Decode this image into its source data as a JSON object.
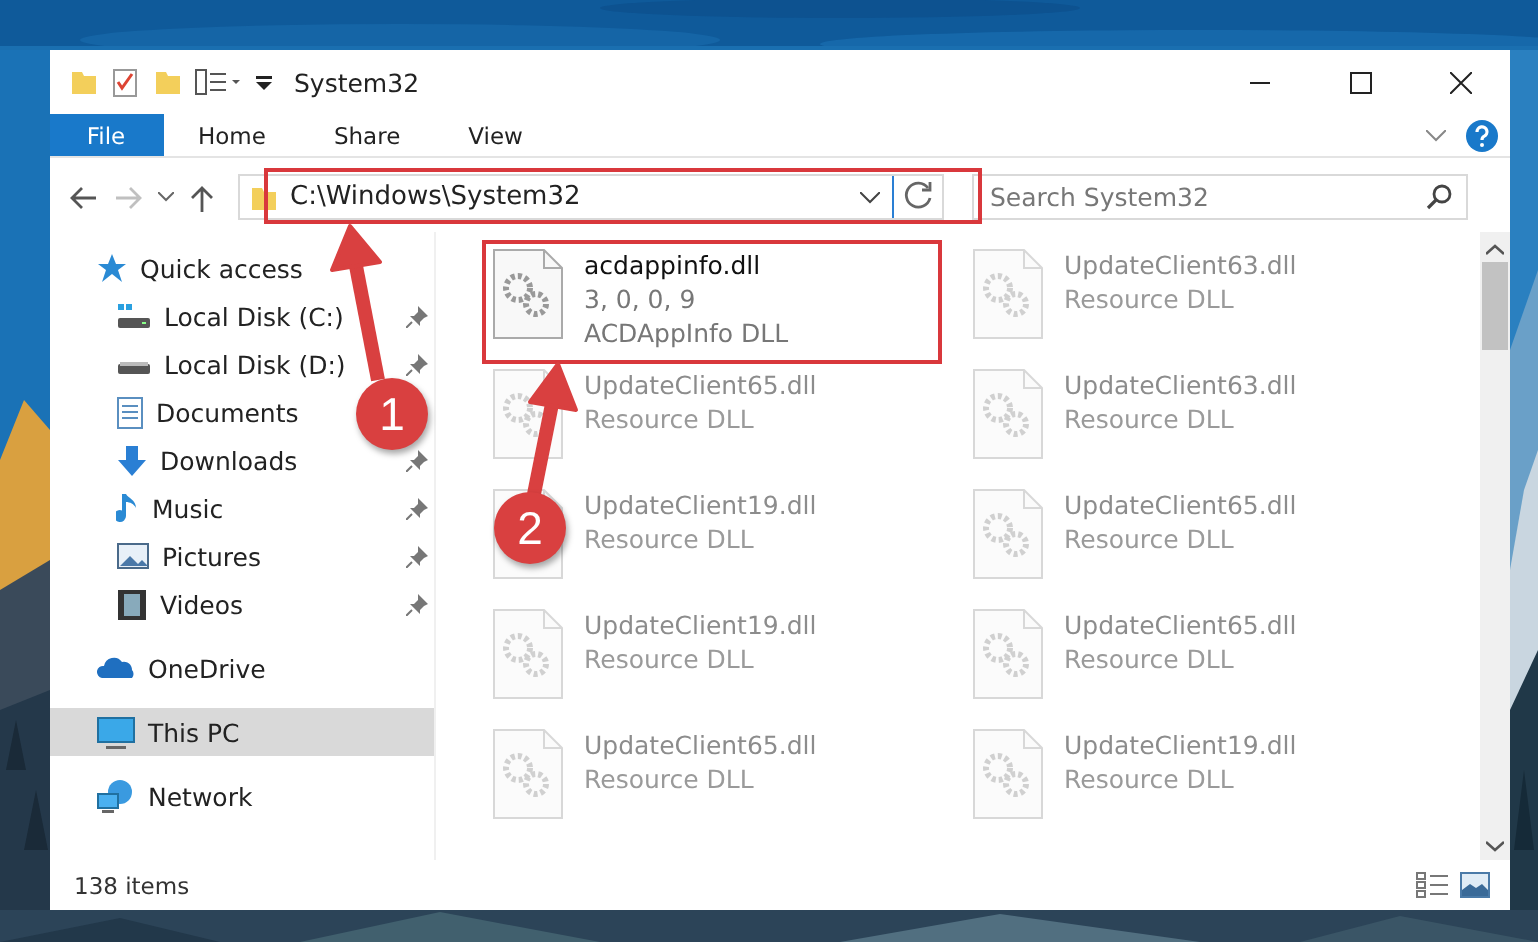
{
  "window": {
    "title": "System32"
  },
  "ribbon_tabs": [
    {
      "label": "File",
      "selected": true
    },
    {
      "label": "Home",
      "selected": false
    },
    {
      "label": "Share",
      "selected": false
    },
    {
      "label": "View",
      "selected": false
    }
  ],
  "address_bar": {
    "path": "C:\\Windows\\System32"
  },
  "search": {
    "placeholder": "Search System32"
  },
  "sidebar": {
    "items": [
      {
        "label": "Quick access",
        "selected": false,
        "children": [
          {
            "label": "Local Disk (C:)",
            "pinned": true,
            "selected": false
          },
          {
            "label": "Local Disk (D:)",
            "pinned": true,
            "selected": false
          },
          {
            "label": "Documents",
            "pinned": false,
            "selected": false
          },
          {
            "label": "Downloads",
            "pinned": true,
            "selected": false
          },
          {
            "label": "Music",
            "pinned": true,
            "selected": false
          },
          {
            "label": "Pictures",
            "pinned": true,
            "selected": false
          },
          {
            "label": "Videos",
            "pinned": true,
            "selected": false
          }
        ]
      },
      {
        "label": "OneDrive",
        "selected": false
      },
      {
        "label": "This PC",
        "selected": true
      },
      {
        "label": "Network",
        "selected": false
      }
    ]
  },
  "files": [
    {
      "name": "acdappinfo.dll",
      "lines": [
        "3, 0, 0, 9",
        "ACDAppInfo DLL"
      ],
      "kind": "highlighted"
    },
    {
      "name": "UpdateClient65.dll",
      "lines": [
        "Resource DLL"
      ],
      "kind": "faded"
    },
    {
      "name": "UpdateClient19.dll",
      "lines": [
        "Resource DLL"
      ],
      "kind": "faded"
    },
    {
      "name": "UpdateClient19.dll",
      "lines": [
        "Resource DLL"
      ],
      "kind": "faded"
    },
    {
      "name": "UpdateClient65.dll",
      "lines": [
        "Resource DLL"
      ],
      "kind": "faded"
    },
    {
      "name": "UpdateClient63.dll",
      "lines": [
        "Resource DLL"
      ],
      "kind": "faded"
    },
    {
      "name": "UpdateClient63.dll",
      "lines": [
        "Resource DLL"
      ],
      "kind": "faded"
    },
    {
      "name": "UpdateClient65.dll",
      "lines": [
        "Resource DLL"
      ],
      "kind": "faded"
    },
    {
      "name": "UpdateClient65.dll",
      "lines": [
        "Resource DLL"
      ],
      "kind": "faded"
    },
    {
      "name": "UpdateClient19.dll",
      "lines": [
        "Resource DLL"
      ],
      "kind": "faded"
    }
  ],
  "status_bar": {
    "item_count": "138 items"
  },
  "annotations": [
    {
      "label": "1"
    },
    {
      "label": "2"
    }
  ]
}
